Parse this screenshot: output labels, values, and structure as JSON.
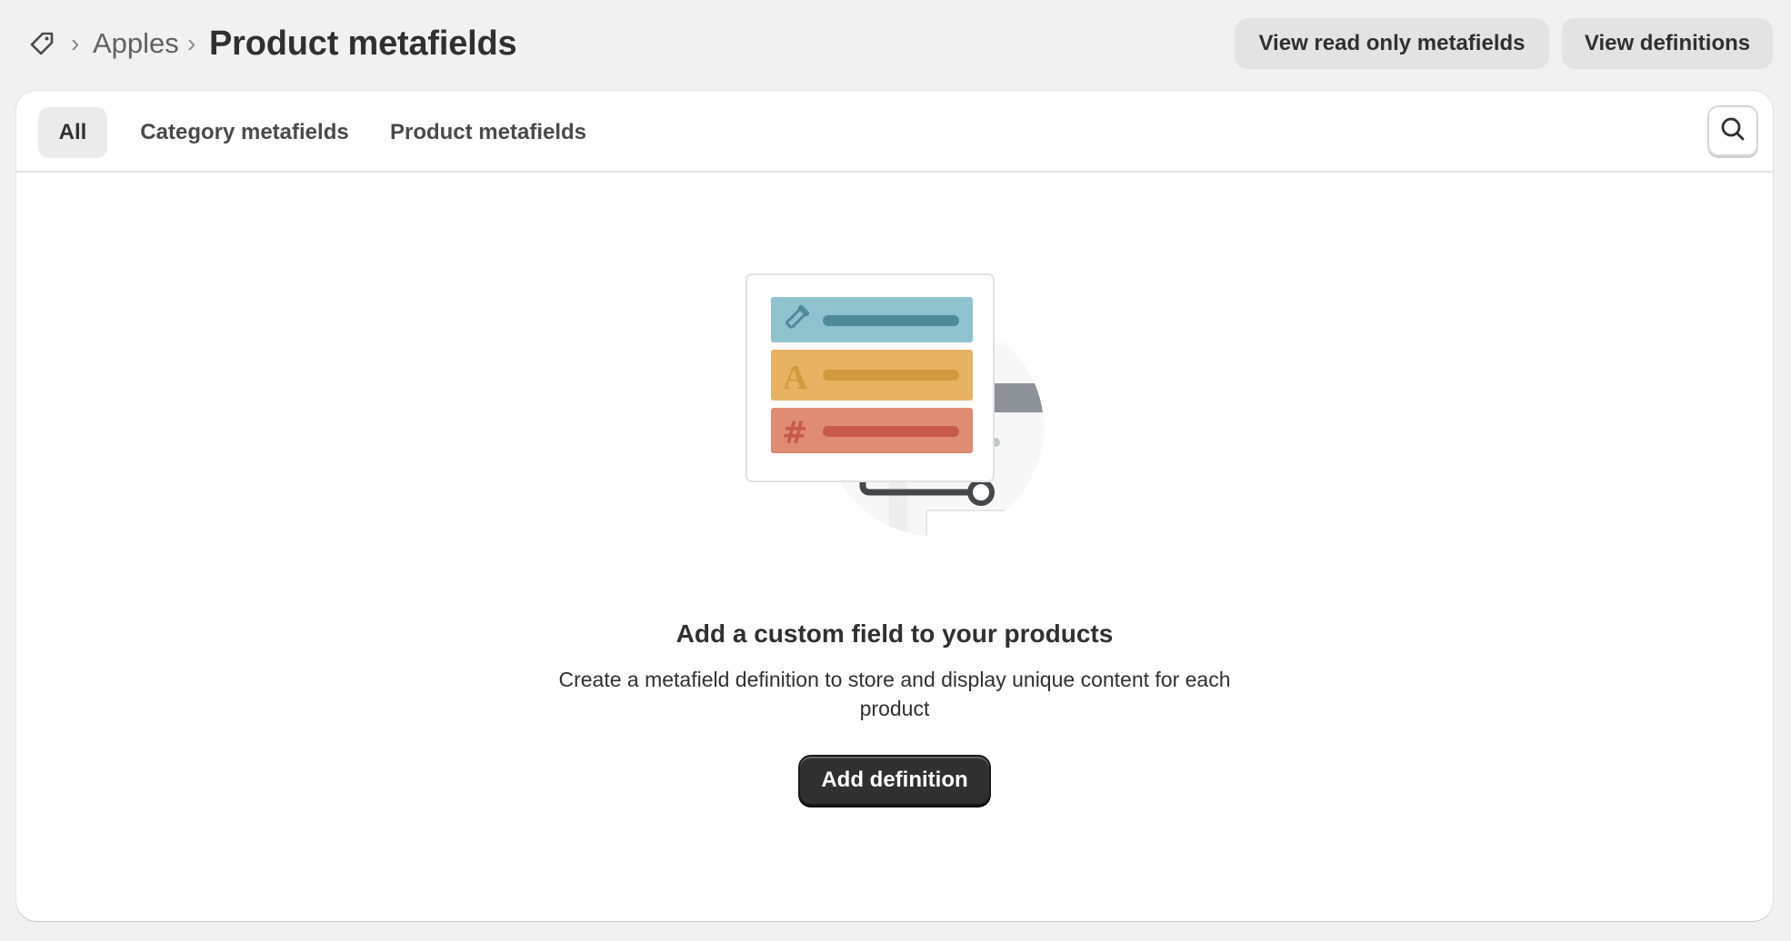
{
  "header": {
    "breadcrumb_icon": "tag-icon",
    "breadcrumb_separator": "›",
    "breadcrumb_link": "Apples",
    "title": "Product metafields",
    "actions": {
      "read_only": "View read only metafields",
      "definitions": "View definitions"
    }
  },
  "tabs": [
    {
      "label": "All",
      "selected": true
    },
    {
      "label": "Category metafields",
      "selected": false
    },
    {
      "label": "Product metafields",
      "selected": false
    }
  ],
  "search": {
    "icon": "search-icon"
  },
  "empty_state": {
    "illustration": "metafield-illustration",
    "heading": "Add a custom field to your products",
    "description": "Create a metafield definition to store and display unique content for each product",
    "primary_action": "Add definition"
  },
  "colors": {
    "background": "#f1f1f1",
    "card": "#ffffff",
    "primary_button": "#303030",
    "teal": "#8ec3ce",
    "yellow": "#e7b262",
    "red": "#e08b74"
  }
}
